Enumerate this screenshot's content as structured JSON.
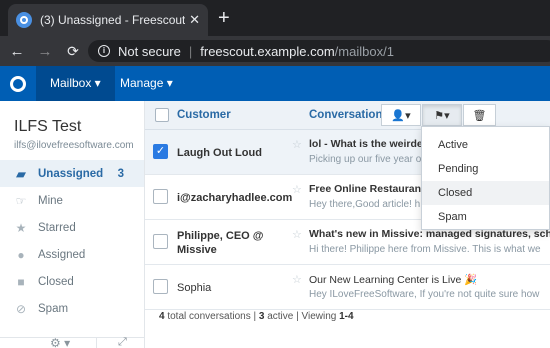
{
  "browser": {
    "tab_title": "(3) Unassigned - Freescout",
    "tab_close": "✕",
    "new_tab": "+",
    "back": "←",
    "forward": "→",
    "reload": "C",
    "info": "i",
    "not_secure": "Not secure",
    "separator": "|",
    "url_host": "freescout.example.com",
    "url_path": "/mailbox/1"
  },
  "app_nav": {
    "items": [
      {
        "label": "Mailbox ▾",
        "active": true
      },
      {
        "label": "Manage ▾",
        "active": false
      }
    ]
  },
  "sidebar": {
    "mailbox_name": "ILFS Test",
    "mailbox_email": "ilfs@ilovefreesoftware.com",
    "folders": [
      {
        "label": "Unassigned",
        "count": "3",
        "icon": "folder-open-icon",
        "glyph": "▰",
        "active": true
      },
      {
        "label": "Mine",
        "count": "",
        "icon": "hand-icon",
        "glyph": "☞",
        "active": false
      },
      {
        "label": "Starred",
        "count": "",
        "icon": "star-icon",
        "glyph": "★",
        "active": false
      },
      {
        "label": "Assigned",
        "count": "",
        "icon": "user-icon",
        "glyph": "●",
        "active": false
      },
      {
        "label": "Closed",
        "count": "",
        "icon": "lock-icon",
        "glyph": "■",
        "active": false
      },
      {
        "label": "Spam",
        "count": "",
        "icon": "ban-icon",
        "glyph": "⊘",
        "active": false
      }
    ],
    "footer_gear": "⚙ ▾",
    "footer_expand": "⤢"
  },
  "list": {
    "header_customer": "Customer",
    "header_conversation": "Conversation",
    "btn_assign": "▲▾",
    "btn_status": "⚑▾",
    "btn_delete": "🗑",
    "rows": [
      {
        "customer": "Laugh Out Loud",
        "subject": "lol - What is the weirdest",
        "preview": "Picking up our five year old",
        "selected": true,
        "bold": true,
        "star": "☆",
        "check": "✓"
      },
      {
        "customer": "i@zacharyhadlee.com",
        "subject": "Free Online Restaurant",
        "preview": "Hey there,Good article! h",
        "selected": false,
        "bold": true,
        "star": "☆",
        "check": ""
      },
      {
        "customer": "Philippe, CEO @ Missive",
        "subject": "What's new in Missive: managed signatures, sch",
        "preview": "Hi there! Philippe here from Missive. This is what we",
        "selected": false,
        "bold": true,
        "star": "☆",
        "check": ""
      },
      {
        "customer": "Sophia",
        "subject": "Our New Learning Center is Live 🎉",
        "preview": "Hey ILoveFreeSoftware, If you're not quite sure how",
        "selected": false,
        "bold": false,
        "star": "☆",
        "check": ""
      }
    ],
    "footer": {
      "total": "4",
      "total_text": " total conversations | ",
      "active": "3",
      "active_text": " active | Viewing ",
      "range": "1-4"
    }
  },
  "status_dropdown": {
    "items": [
      "Active",
      "Pending",
      "Closed",
      "Spam"
    ],
    "hovered": "Closed"
  },
  "colors": {
    "brand": "#005eb4",
    "accent": "#2a6aa5"
  }
}
